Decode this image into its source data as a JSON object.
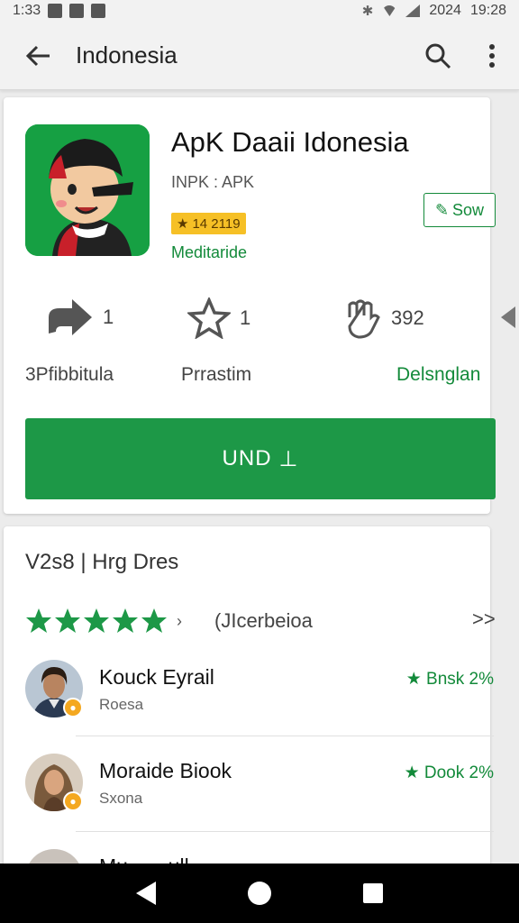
{
  "status_bar": {
    "time_left": "1:33",
    "time_right": "19:28",
    "signal_text": "2024"
  },
  "toolbar": {
    "title": "Indonesia"
  },
  "app": {
    "title": "ApK Daaii  Idonesia",
    "developer": "INPK : APK",
    "rating_badge": "14 2119",
    "category": "Meditaride",
    "follow_label": "Sow",
    "stats": [
      {
        "value": "1",
        "label": "3Pfibbitula"
      },
      {
        "value": "1",
        "label": "Prrastim"
      },
      {
        "value": "392",
        "label": "Delsnglan"
      }
    ],
    "install_label": "UND"
  },
  "reviews": {
    "header": "V2s8 | Hrg Dres",
    "subtitle": "(JIcerbeioa",
    "more": ">>",
    "star_count": 5,
    "items": [
      {
        "name": "Kouck Eyrail",
        "subtitle": "Roesa",
        "score": "Bnsk 2%"
      },
      {
        "name": "Moraide Biook",
        "subtitle": "Sxona",
        "score": "Dook 2%"
      },
      {
        "name": "Mu... ...ull",
        "subtitle": "",
        "score": "..."
      }
    ]
  },
  "colors": {
    "accent": "#1d9847",
    "accent_text": "#138a3a",
    "badge": "#f6c026"
  }
}
